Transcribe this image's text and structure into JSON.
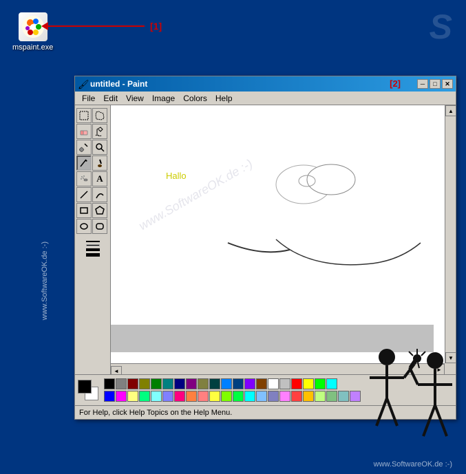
{
  "desktop": {
    "background_color": "#003580"
  },
  "annotation1": {
    "label": "[1]",
    "color": "#cc0000"
  },
  "annotation2": {
    "label": "[2]",
    "color": "#cc0000"
  },
  "mspaint": {
    "label": "mspaint.exe",
    "icon_emoji": "🎨"
  },
  "paint_window": {
    "title": "untitled - Paint",
    "title_icon": "🖌",
    "menu_items": [
      "File",
      "Edit",
      "View",
      "Image",
      "Colors",
      "Help"
    ],
    "controls": {
      "minimize": "─",
      "maximize": "□",
      "close": "✕"
    }
  },
  "canvas": {
    "hallo_text": "Hallo",
    "hallo_color": "#cccc00"
  },
  "status_bar": {
    "text": "For Help, click Help Topics on the Help Menu."
  },
  "toolbar": {
    "tools": [
      {
        "name": "select-rect",
        "icon": "⬚"
      },
      {
        "name": "select-free",
        "icon": "✦"
      },
      {
        "name": "eraser",
        "icon": "⬜"
      },
      {
        "name": "fill",
        "icon": "⬛"
      },
      {
        "name": "eyedropper",
        "icon": "💉"
      },
      {
        "name": "magnifier",
        "icon": "🔍"
      },
      {
        "name": "pencil",
        "icon": "✏"
      },
      {
        "name": "brush",
        "icon": "🖌"
      },
      {
        "name": "airbrush",
        "icon": "💨"
      },
      {
        "name": "text",
        "icon": "A"
      },
      {
        "name": "line",
        "icon": "╱"
      },
      {
        "name": "curve",
        "icon": "∫"
      },
      {
        "name": "rect",
        "icon": "□"
      },
      {
        "name": "polygon",
        "icon": "⬟"
      },
      {
        "name": "ellipse",
        "icon": "○"
      },
      {
        "name": "rounded-rect",
        "icon": "▢"
      }
    ]
  },
  "palette": {
    "colors": [
      "#000000",
      "#808080",
      "#800000",
      "#808000",
      "#008000",
      "#008080",
      "#000080",
      "#800080",
      "#808040",
      "#004040",
      "#0080ff",
      "#004080",
      "#8000ff",
      "#804000",
      "#ffffff",
      "#c0c0c0",
      "#ff0000",
      "#ffff00",
      "#00ff00",
      "#00ffff",
      "#0000ff",
      "#ff00ff",
      "#ffff80",
      "#00ff80",
      "#80ffff",
      "#8080ff",
      "#ff0080",
      "#ff8040",
      "#ff8080",
      "#ffff40",
      "#80ff00",
      "#00ff40",
      "#00ffff",
      "#80c0ff",
      "#8080c0",
      "#ff80ff",
      "#ff4040",
      "#ffc000",
      "#c0ff80",
      "#80c080",
      "#80c0c0",
      "#c080ff"
    ],
    "fg_color": "#000000",
    "bg_color": "#ffffff"
  },
  "branding": {
    "left_text": "www.SoftwareOK.de :-)",
    "bottom_text": "www.SoftwareOK.de :-)"
  }
}
